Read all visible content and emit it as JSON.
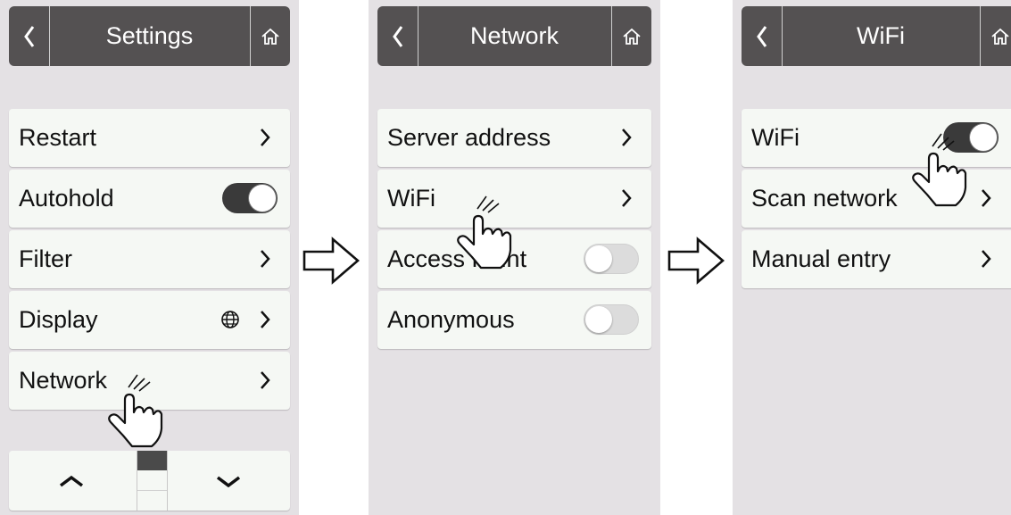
{
  "screens": [
    {
      "title": "Settings",
      "items": [
        {
          "label": "Restart",
          "control": "chevron"
        },
        {
          "label": "Autohold",
          "control": "toggle",
          "state": "on"
        },
        {
          "label": "Filter",
          "control": "chevron"
        },
        {
          "label": "Display",
          "control": "chevron",
          "icon": "globe-icon"
        },
        {
          "label": "Network",
          "control": "chevron"
        }
      ],
      "scroll": {
        "up_icon": "chevron-up-icon",
        "down_icon": "chevron-down-icon"
      }
    },
    {
      "title": "Network",
      "items": [
        {
          "label": "Server address",
          "control": "chevron"
        },
        {
          "label": "WiFi",
          "control": "chevron"
        },
        {
          "label": "Access Point",
          "control": "toggle",
          "state": "off"
        },
        {
          "label": "Anonymous",
          "control": "toggle",
          "state": "off"
        }
      ]
    },
    {
      "title": "WiFi",
      "items": [
        {
          "label": "WiFi",
          "control": "toggle",
          "state": "on"
        },
        {
          "label": "Scan network",
          "control": "chevron"
        },
        {
          "label": "Manual entry",
          "control": "chevron"
        }
      ]
    }
  ],
  "icons": {
    "back": "chevron-left-icon",
    "home": "home-icon",
    "navigate": "right-arrow-icon",
    "tap": "tap-hand-icon"
  },
  "colors": {
    "header_bg": "#545152",
    "screen_bg": "#e4e1e4",
    "row_bg": "#f5f8f4",
    "toggle_on": "#3a3a3a",
    "toggle_off": "#dcdcdc"
  }
}
